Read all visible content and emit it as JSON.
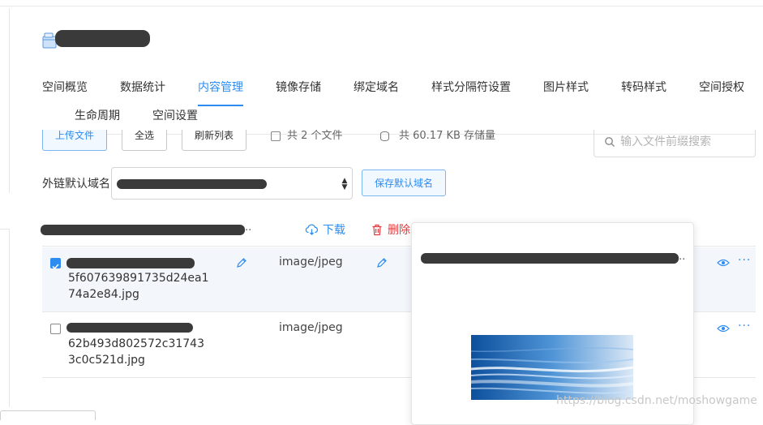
{
  "tabs": {
    "row1": [
      "空间概览",
      "数据统计",
      "内容管理",
      "镜像存储",
      "绑定域名",
      "样式分隔符设置",
      "图片样式",
      "转码样式",
      "空间授权"
    ],
    "row2": [
      "生命周期",
      "空间设置"
    ],
    "active": "内容管理"
  },
  "toolbar": {
    "upload": "上传文件",
    "select_all": "全选",
    "refresh": "刷新列表",
    "file_count": "共 2 个文件",
    "storage": "共 60.17 KB 存储量",
    "search_placeholder": "输入文件前缀搜索"
  },
  "domain": {
    "label": "外链默认域名",
    "save": "保存默认域名"
  },
  "list_header": {
    "ellipsis": "..",
    "download": "下载",
    "delete": "删除"
  },
  "files": [
    {
      "checked": true,
      "name_lines": [
        "5f607639891735d24ea1",
        "74a2e84.jpg"
      ],
      "mime": "image/jpeg"
    },
    {
      "checked": false,
      "name_lines": [
        "62b493d802572c31743",
        "3c0c521d.jpg"
      ],
      "mime": "image/jpeg"
    }
  ],
  "popover": {
    "ellipsis": ".."
  },
  "watermark": "https://blog.csdn.net/moshowgame",
  "colors": {
    "accent": "#2d8cf0",
    "danger": "#e4393c",
    "selected_row": "#f3f7fc"
  }
}
